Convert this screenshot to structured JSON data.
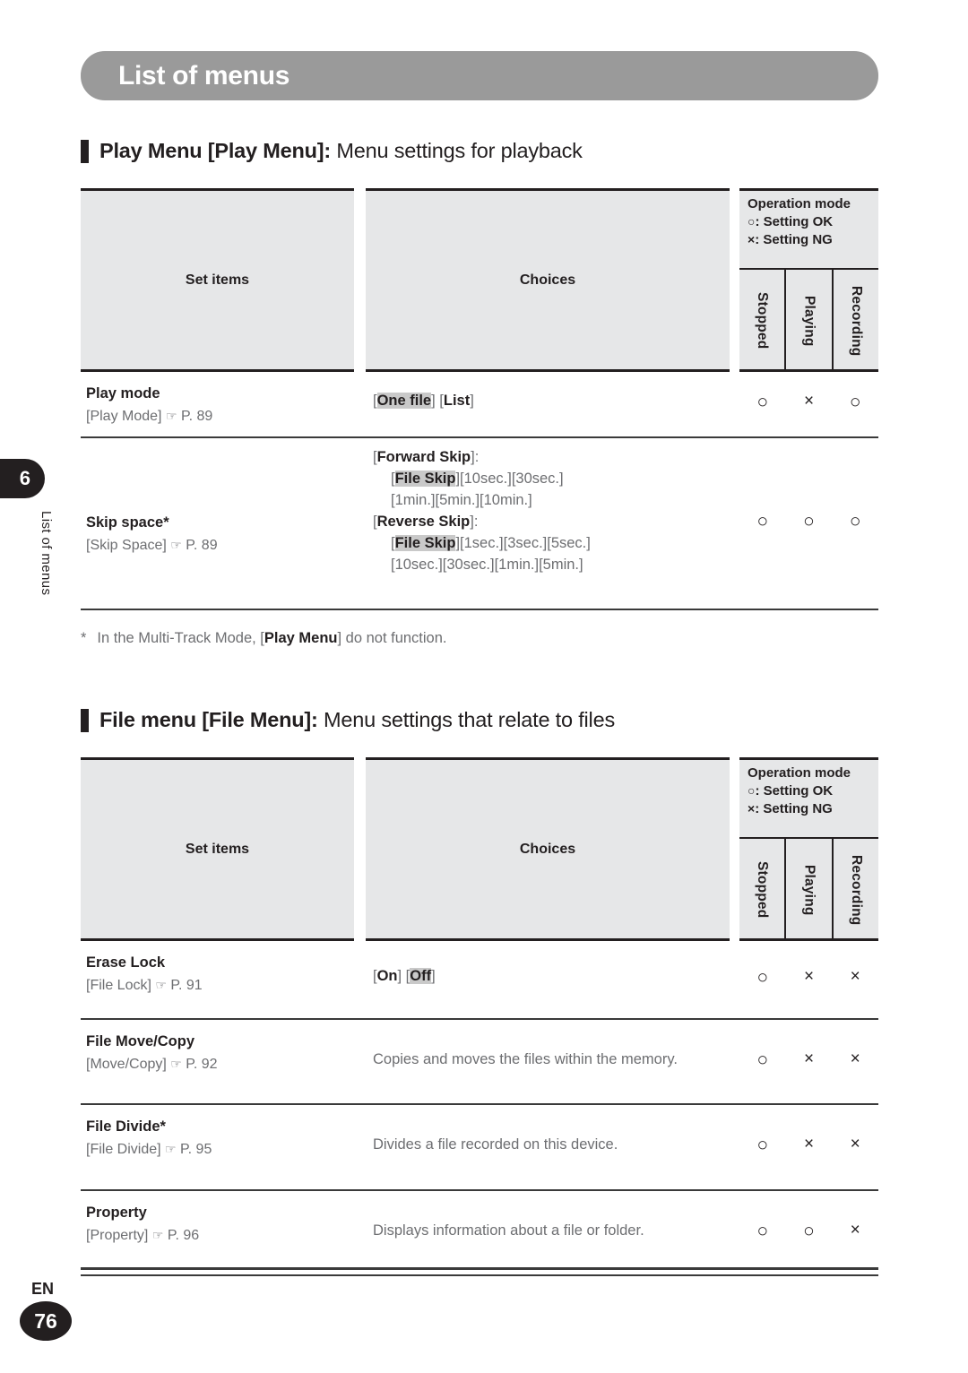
{
  "banner": {
    "title": "List of menus"
  },
  "chapter_tab": {
    "number": "6",
    "label": "List of menus"
  },
  "sections": [
    {
      "heading_bold": "Play Menu [Play Menu]:",
      "heading_regular": " Menu settings for playback",
      "column_headers": {
        "set_items": "Set items",
        "choices": "Choices",
        "operation_mode": "Operation mode",
        "legend_ok_symbol": "○",
        "legend_ok": ": Setting OK",
        "legend_ng_symbol": "×",
        "legend_ng": ": Setting NG",
        "sub_stopped": "Stopped",
        "sub_playing": "Playing",
        "sub_recording": "Recording"
      },
      "rows": [
        {
          "title": "Play mode",
          "sub_bracket": "[Play Mode]",
          "hand": "☞",
          "page": "P. 89",
          "choice_lines": [
            {
              "indent": false,
              "parts": [
                {
                  "t": "[",
                  "bold": false,
                  "hl": false
                },
                {
                  "t": "One file",
                  "bold": true,
                  "hl": true
                },
                {
                  "t": "] [",
                  "bold": false,
                  "hl": false
                },
                {
                  "t": "List",
                  "bold": true,
                  "hl": false
                },
                {
                  "t": "]",
                  "bold": false,
                  "hl": false
                }
              ]
            }
          ],
          "ops": [
            "○",
            "×",
            "○"
          ]
        },
        {
          "title": "Skip space*",
          "sub_bracket": "[Skip Space]",
          "hand": "☞",
          "page": "P. 89",
          "choice_lines": [
            {
              "indent": false,
              "parts": [
                {
                  "t": "[",
                  "bold": false,
                  "hl": false
                },
                {
                  "t": "Forward Skip",
                  "bold": true,
                  "hl": false
                },
                {
                  "t": "]:",
                  "bold": false,
                  "hl": false
                }
              ]
            },
            {
              "indent": true,
              "parts": [
                {
                  "t": "[",
                  "bold": false,
                  "hl": false
                },
                {
                  "t": "File Skip",
                  "bold": true,
                  "hl": true
                },
                {
                  "t": "][10sec.][30sec.]",
                  "bold": false,
                  "hl": false
                }
              ]
            },
            {
              "indent": true,
              "parts": [
                {
                  "t": "[1min.][5min.][10min.]",
                  "bold": false,
                  "hl": false
                }
              ]
            },
            {
              "indent": false,
              "parts": [
                {
                  "t": "[",
                  "bold": false,
                  "hl": false
                },
                {
                  "t": "Reverse Skip",
                  "bold": true,
                  "hl": false
                },
                {
                  "t": "]:",
                  "bold": false,
                  "hl": false
                }
              ]
            },
            {
              "indent": true,
              "parts": [
                {
                  "t": "[",
                  "bold": false,
                  "hl": false
                },
                {
                  "t": "File Skip",
                  "bold": true,
                  "hl": true
                },
                {
                  "t": "][1sec.][3sec.][5sec.]",
                  "bold": false,
                  "hl": false
                }
              ]
            },
            {
              "indent": true,
              "parts": [
                {
                  "t": "[10sec.][30sec.][1min.][5min.]",
                  "bold": false,
                  "hl": false
                }
              ]
            }
          ],
          "ops": [
            "○",
            "○",
            "○"
          ]
        }
      ],
      "footnote": {
        "asterisk": "*",
        "pre": "In the Multi-Track Mode, [",
        "bold": "Play Menu",
        "post": "] do not function."
      }
    },
    {
      "heading_bold": "File menu [File Menu]:",
      "heading_regular": " Menu settings that relate to files",
      "column_headers": {
        "set_items": "Set items",
        "choices": "Choices",
        "operation_mode": "Operation mode",
        "legend_ok_symbol": "○",
        "legend_ok": ": Setting OK",
        "legend_ng_symbol": "×",
        "legend_ng": ": Setting NG",
        "sub_stopped": "Stopped",
        "sub_playing": "Playing",
        "sub_recording": "Recording"
      },
      "rows": [
        {
          "title": "Erase Lock",
          "sub_bracket": "[File Lock]",
          "hand": "☞",
          "page": "P. 91",
          "choice_lines": [
            {
              "indent": false,
              "parts": [
                {
                  "t": "[",
                  "bold": false,
                  "hl": false
                },
                {
                  "t": "On",
                  "bold": true,
                  "hl": false
                },
                {
                  "t": "] [",
                  "bold": false,
                  "hl": false
                },
                {
                  "t": "Off",
                  "bold": true,
                  "hl": true
                },
                {
                  "t": "]",
                  "bold": false,
                  "hl": false
                }
              ]
            }
          ],
          "ops": [
            "○",
            "×",
            "×"
          ]
        },
        {
          "title": "File Move/Copy",
          "sub_bracket": "[Move/Copy]",
          "hand": "☞",
          "page": "P. 92",
          "description": "Copies and moves the files within the memory.",
          "ops": [
            "○",
            "×",
            "×"
          ]
        },
        {
          "title": "File Divide*",
          "sub_bracket": "[File Divide]",
          "hand": "☞",
          "page": "P. 95",
          "description": "Divides a file recorded on this device.",
          "ops": [
            "○",
            "×",
            "×"
          ]
        },
        {
          "title": "Property",
          "sub_bracket": "[Property]",
          "hand": "☞",
          "page": "P. 96",
          "description": "Displays information about a file or folder.",
          "ops": [
            "○",
            "○",
            "×"
          ]
        }
      ]
    }
  ],
  "footer": {
    "language": "EN",
    "page_number": "76"
  }
}
